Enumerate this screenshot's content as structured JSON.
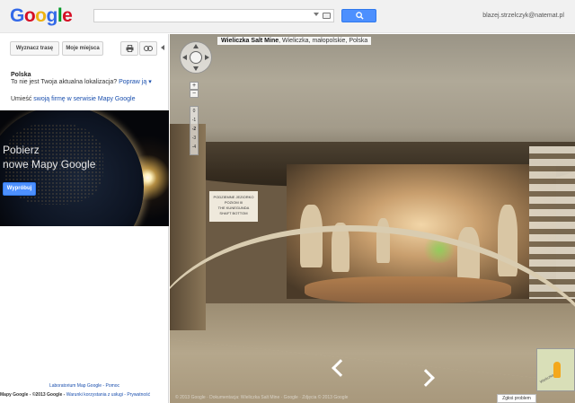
{
  "header": {
    "logo": [
      "G",
      "o",
      "o",
      "g",
      "l",
      "e"
    ],
    "logo_colors": [
      "#3369e8",
      "#d50f25",
      "#eeb211",
      "#3369e8",
      "#009925",
      "#d50f25"
    ],
    "search_placeholder": "",
    "user": "blazej.strzelczyk@natemat.pl"
  },
  "sidebar": {
    "route_button": "Wyznacz trasę",
    "places_button": "Moje miejsca",
    "place_name": "Polska",
    "location_text": "To nie jest Twoja aktualna lokalizacja?",
    "location_fix": "Popraw ją ▾",
    "business_prefix": "Umieść",
    "business_link": "swoją firmę w serwisie Mapy Google",
    "promo_text_1": "Pobierz",
    "promo_text_2": "nowe Mapy Google",
    "promo_button": "Wypróbuj",
    "footer_links": "Laboratorium Map Google - Pomoc",
    "footer_legal_prefix": "Mapy Google - ©2013 Google -",
    "footer_legal_links": "Warunki korzystania z usługi - Prywatność"
  },
  "streetview": {
    "title_bold": "Wieliczka Salt Mine",
    "title_rest": ", Wieliczka, małopolskie, Polska",
    "sign_text": "PODZIEMNE JEZIORKO\nPOZIOM III\nTHE KUNEGUNDA\nSHAFT BOTTOM",
    "zoom_plus": "+",
    "zoom_minus": "−",
    "zoom_levels": [
      "0",
      "-1",
      "-2",
      "-3",
      "-4"
    ],
    "copyright": "© 2013 Google · Dokumentacja: Wieliczka Salt Mine · Google · Zdjęcia © 2013 Google",
    "report": "Zgłoś problem",
    "minimap_label": "Wieliczka"
  }
}
